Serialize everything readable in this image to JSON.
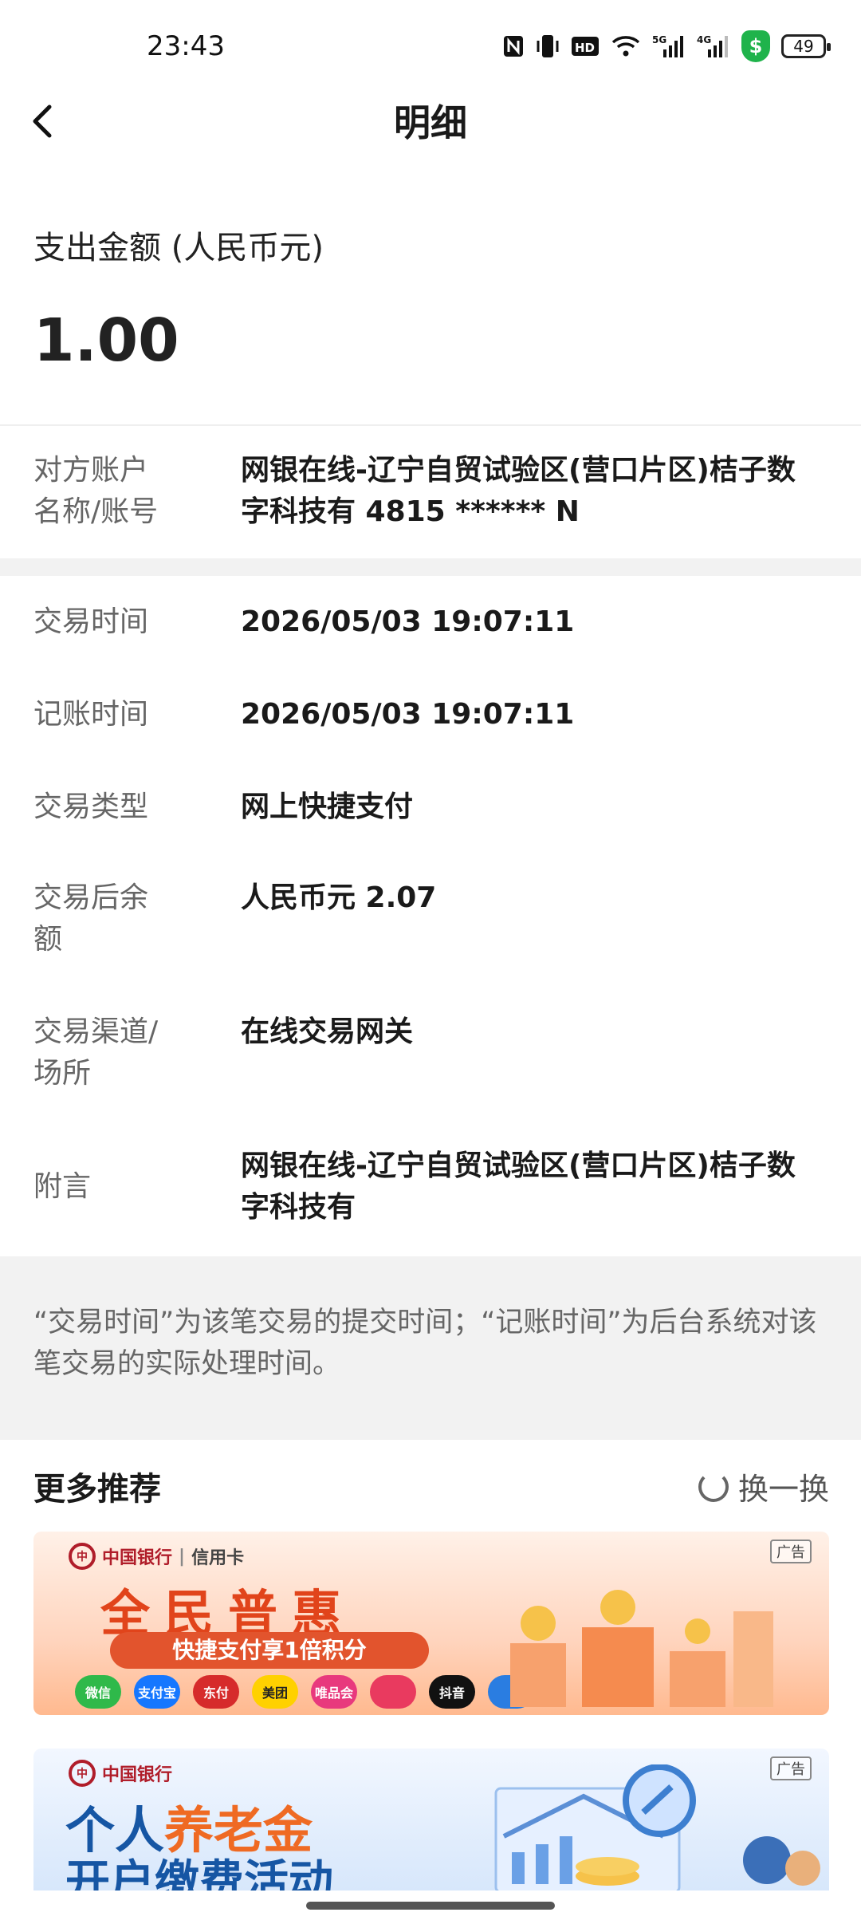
{
  "status": {
    "time": "23:43",
    "battery": "49",
    "icons": [
      "nfc-icon",
      "vibrate-icon",
      "hd-icon",
      "wifi-icon",
      "5g-signal-icon",
      "4g-signal-icon",
      "security-shield-icon",
      "battery-icon"
    ]
  },
  "header": {
    "back_icon": "chevron-left-icon",
    "title": "明细"
  },
  "summary": {
    "amount_label": "支出金额 (人民币元)",
    "amount": "1.00"
  },
  "counterparty": {
    "label": "对方账户\n名称/账号",
    "value": "网银在线-辽宁自贸试验区(营口片区)桔子数字科技有 4815 ****** N"
  },
  "details": [
    {
      "label": "交易时间",
      "value": "2026/05/03 19:07:11"
    },
    {
      "label": "记账时间",
      "value": "2026/05/03 19:07:11"
    },
    {
      "label": "交易类型",
      "value": "网上快捷支付"
    },
    {
      "label": "交易后余额",
      "value": "人民币元 2.07"
    },
    {
      "label": "交易渠道/场所",
      "value": "在线交易网关"
    },
    {
      "label": "附言",
      "value": "网银在线-辽宁自贸试验区(营口片区)桔子数字科技有"
    }
  ],
  "note": "“交易时间”为该笔交易的提交时间；“记账时间”为后台系统对该笔交易的实际处理时间。",
  "recommend": {
    "title": "更多推荐",
    "refresh_label": "换一换",
    "banner1": {
      "logo": "中国银行",
      "sub": "信用卡",
      "ad_tag": "广告",
      "headline": "全民普惠",
      "pill": "快捷支付享1倍积分",
      "apps": [
        "微信",
        "支付宝",
        "东付",
        "美团",
        "唯品会",
        "",
        "抖音",
        ""
      ]
    },
    "banner2": {
      "logo": "中国银行",
      "ad_tag": "广告",
      "line1_a": "个人",
      "line1_b": "养老金",
      "line2": "开户缴费活动"
    }
  },
  "colors": {
    "accent": "#1fb34b",
    "banner_orange": "#e1441b",
    "banner_blue": "#1656a4"
  }
}
